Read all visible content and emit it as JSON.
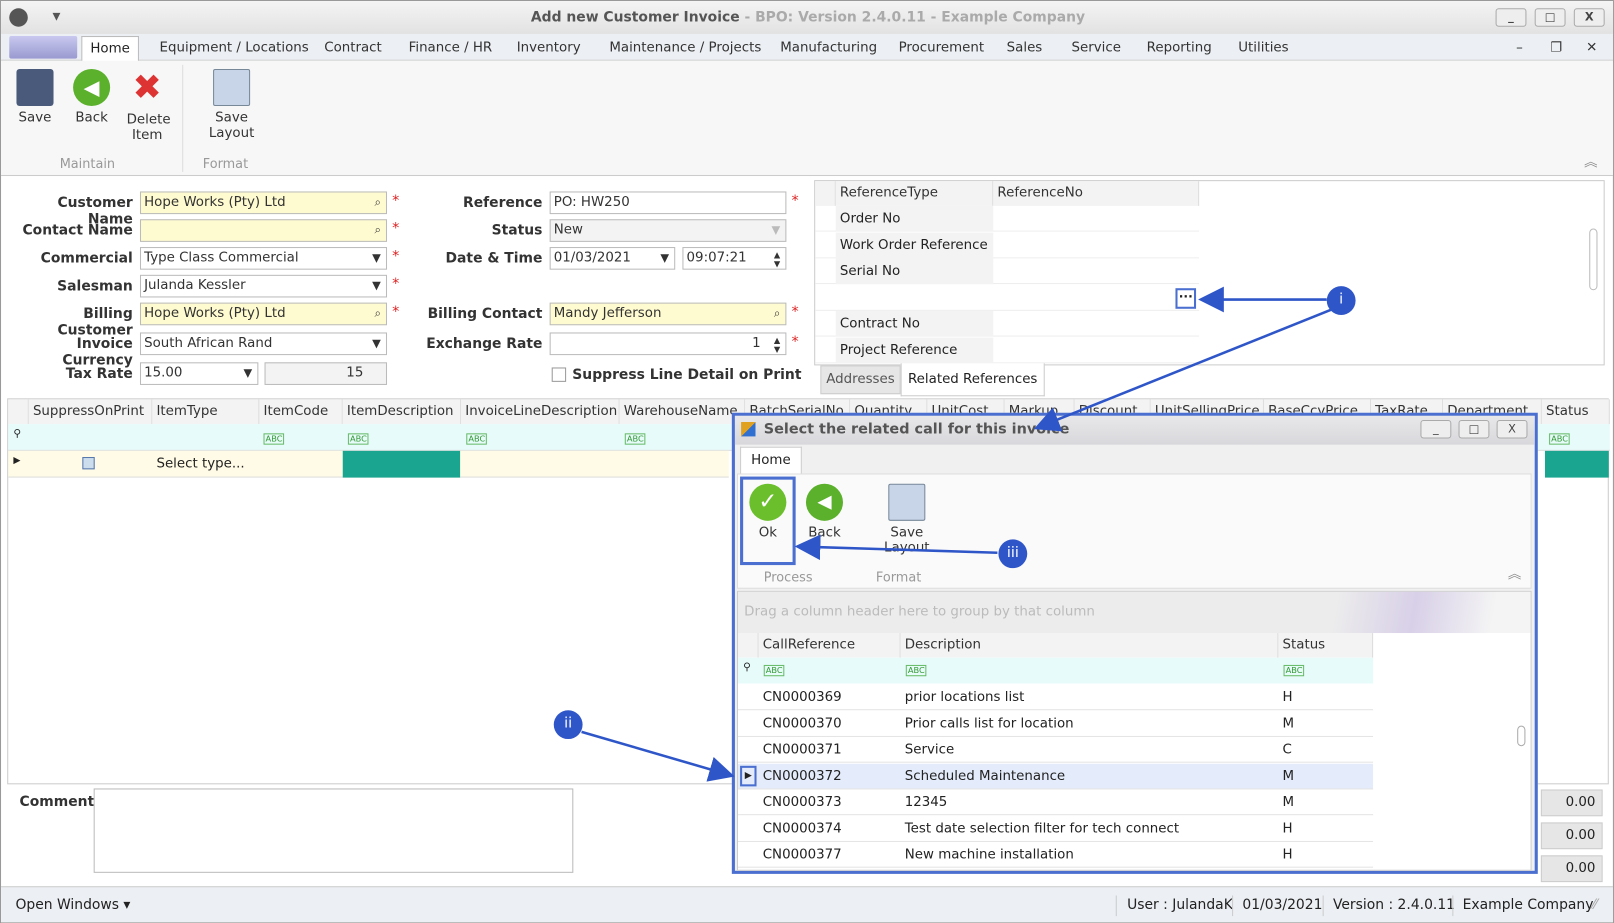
{
  "window": {
    "title": "Add new Customer Invoice",
    "subtitle": " - BPO: Version 2.4.0.11 - Example Company"
  },
  "menu": [
    "Home",
    "Equipment / Locations",
    "Contract",
    "Finance / HR",
    "Inventory",
    "Maintenance / Projects",
    "Manufacturing",
    "Procurement",
    "Sales",
    "Service",
    "Reporting",
    "Utilities"
  ],
  "ribbon": {
    "save": "Save",
    "back": "Back",
    "delete": "Delete Item",
    "save_layout": "Save Layout",
    "group_maintain": "Maintain",
    "group_format": "Format"
  },
  "form": {
    "customer_name_label": "Customer Name",
    "customer_name": "Hope Works (Pty) Ltd",
    "contact_name_label": "Contact Name",
    "contact_name": "",
    "commercial_label": "Commercial",
    "commercial": "Type Class Commercial",
    "salesman_label": "Salesman",
    "salesman": "Julanda Kessler",
    "billing_customer_label": "Billing Customer",
    "billing_customer": "Hope Works (Pty) Ltd",
    "invoice_currency_label": "Invoice Currency",
    "invoice_currency": "South African Rand",
    "tax_rate_label": "Tax Rate",
    "tax_rate": "15.00",
    "tax_rate_value": "15",
    "reference_label": "Reference",
    "reference": "PO: HW250",
    "status_label": "Status",
    "status": "New",
    "datetime_label": "Date & Time",
    "date": "01/03/2021",
    "time": "09:07:21",
    "billing_contact_label": "Billing Contact",
    "billing_contact": "Mandy Jefferson",
    "exchange_rate_label": "Exchange Rate",
    "exchange_rate": "1",
    "suppress_label": "Suppress Line Detail on Print",
    "comment_label": "Comment"
  },
  "refs": {
    "headers": [
      "ReferenceType",
      "ReferenceNo"
    ],
    "rows": [
      "Order No",
      "Work Order Reference",
      "Serial No",
      "",
      "Contract No",
      "Project Reference"
    ],
    "tabs": [
      "Addresses",
      "Related References"
    ],
    "ellipsis": "···"
  },
  "lines": {
    "headers": [
      "SuppressOnPrint",
      "ItemType",
      "ItemCode",
      "ItemDescription",
      "InvoiceLineDescription",
      "WarehouseName",
      "BatchSerialNo",
      "Quantity",
      "UnitCost",
      "Markup",
      "Discount",
      "UnitSellingPrice",
      "BaseCcyPrice",
      "TaxRate",
      "Department",
      "Status"
    ],
    "select_type": "Select type...",
    "filter_abc": "ABC"
  },
  "totals": [
    "0.00",
    "0.00",
    "0.00"
  ],
  "dialog": {
    "title": "Select the related call for this invoice",
    "tab": "Home",
    "ok": "Ok",
    "back": "Back",
    "save_layout": "Save Layout",
    "group_process": "Process",
    "group_format": "Format",
    "group_hint": "Drag a column header here to group by that column",
    "headers": [
      "CallReference",
      "Description",
      "Status"
    ],
    "rows": [
      [
        "CN0000369",
        "prior locations list",
        "H"
      ],
      [
        "CN0000370",
        "Prior calls list for location",
        "M"
      ],
      [
        "CN0000371",
        "Service",
        "C"
      ],
      [
        "CN0000372",
        "Scheduled Maintenance",
        "M"
      ],
      [
        "CN0000373",
        "12345",
        "M"
      ],
      [
        "CN0000374",
        "Test date selection filter for tech connect",
        "H"
      ],
      [
        "CN0000377",
        "New machine installation",
        "H"
      ]
    ],
    "selected_row": 3
  },
  "annotations": [
    "i",
    "ii",
    "iii"
  ],
  "statusbar": {
    "open_windows": "Open Windows ▾",
    "user": "User : JulandaK",
    "date": "01/03/2021",
    "version": "Version : 2.4.0.11",
    "company": "Example Company"
  },
  "colors": {
    "accent": "#4a6fd0",
    "required": "#dd2222",
    "lookup_yellow": "#fffbd0"
  }
}
